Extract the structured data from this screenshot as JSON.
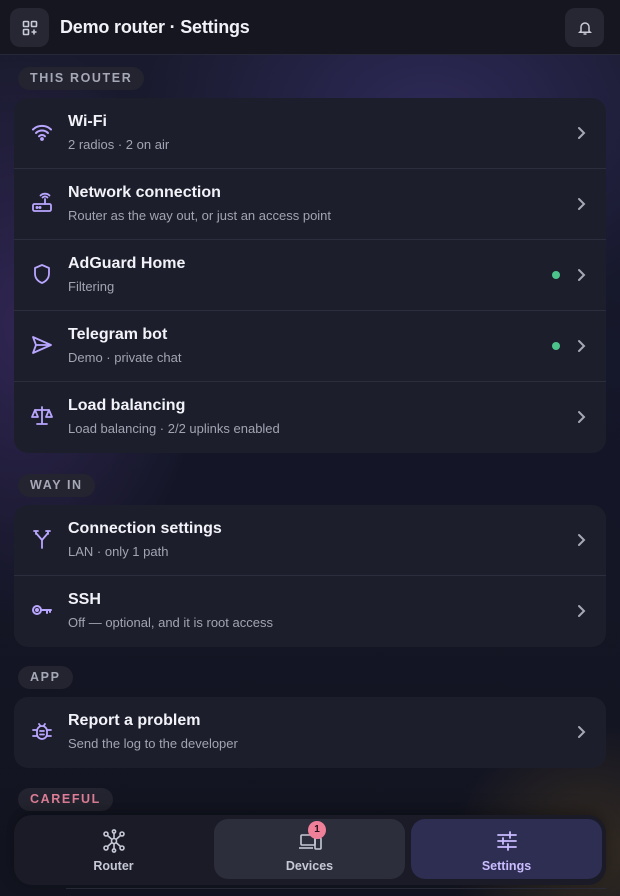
{
  "header": {
    "title": "Demo router · Settings",
    "menu_icon": "apps-grid-icon",
    "bell_icon": "bell-icon"
  },
  "sections": [
    {
      "label": "THIS ROUTER",
      "rows": [
        {
          "title": "Wi-Fi",
          "subtitle": "2 radios · 2 on air",
          "icon": "wifi-icon",
          "status_dot": false
        },
        {
          "title": "Network connection",
          "subtitle": "Router as the way out, or just an access point",
          "icon": "router-icon",
          "status_dot": false
        },
        {
          "title": "AdGuard Home",
          "subtitle": "Filtering",
          "icon": "shield-icon",
          "status_dot": true
        },
        {
          "title": "Telegram bot",
          "subtitle": "Demo · private chat",
          "icon": "send-icon",
          "status_dot": true
        },
        {
          "title": "Load balancing",
          "subtitle": "Load balancing · 2/2 uplinks enabled",
          "icon": "scale-icon",
          "status_dot": false
        }
      ]
    },
    {
      "label": "WAY IN",
      "rows": [
        {
          "title": "Connection settings",
          "subtitle": "LAN · only 1 path",
          "icon": "fork-icon",
          "status_dot": false
        },
        {
          "title": "SSH",
          "subtitle": "Off — optional, and it is root access",
          "icon": "key-icon",
          "status_dot": false
        }
      ]
    },
    {
      "label": "APP",
      "rows": [
        {
          "title": "Report a problem",
          "subtitle": "Send the log to the developer",
          "icon": "bug-icon",
          "status_dot": false
        }
      ]
    },
    {
      "label": "CAREFUL",
      "rows": []
    }
  ],
  "nav": {
    "items": [
      {
        "label": "Router",
        "icon": "network-icon",
        "active": false
      },
      {
        "label": "Devices",
        "icon": "devices-icon",
        "badge": "1",
        "active": false
      },
      {
        "label": "Settings",
        "icon": "sliders-icon",
        "active": true
      }
    ]
  },
  "colors": {
    "accent": "#b9a6ff",
    "status_ok": "#4cc38a",
    "careful": "#e07f97",
    "badge": "#f07f9a"
  }
}
